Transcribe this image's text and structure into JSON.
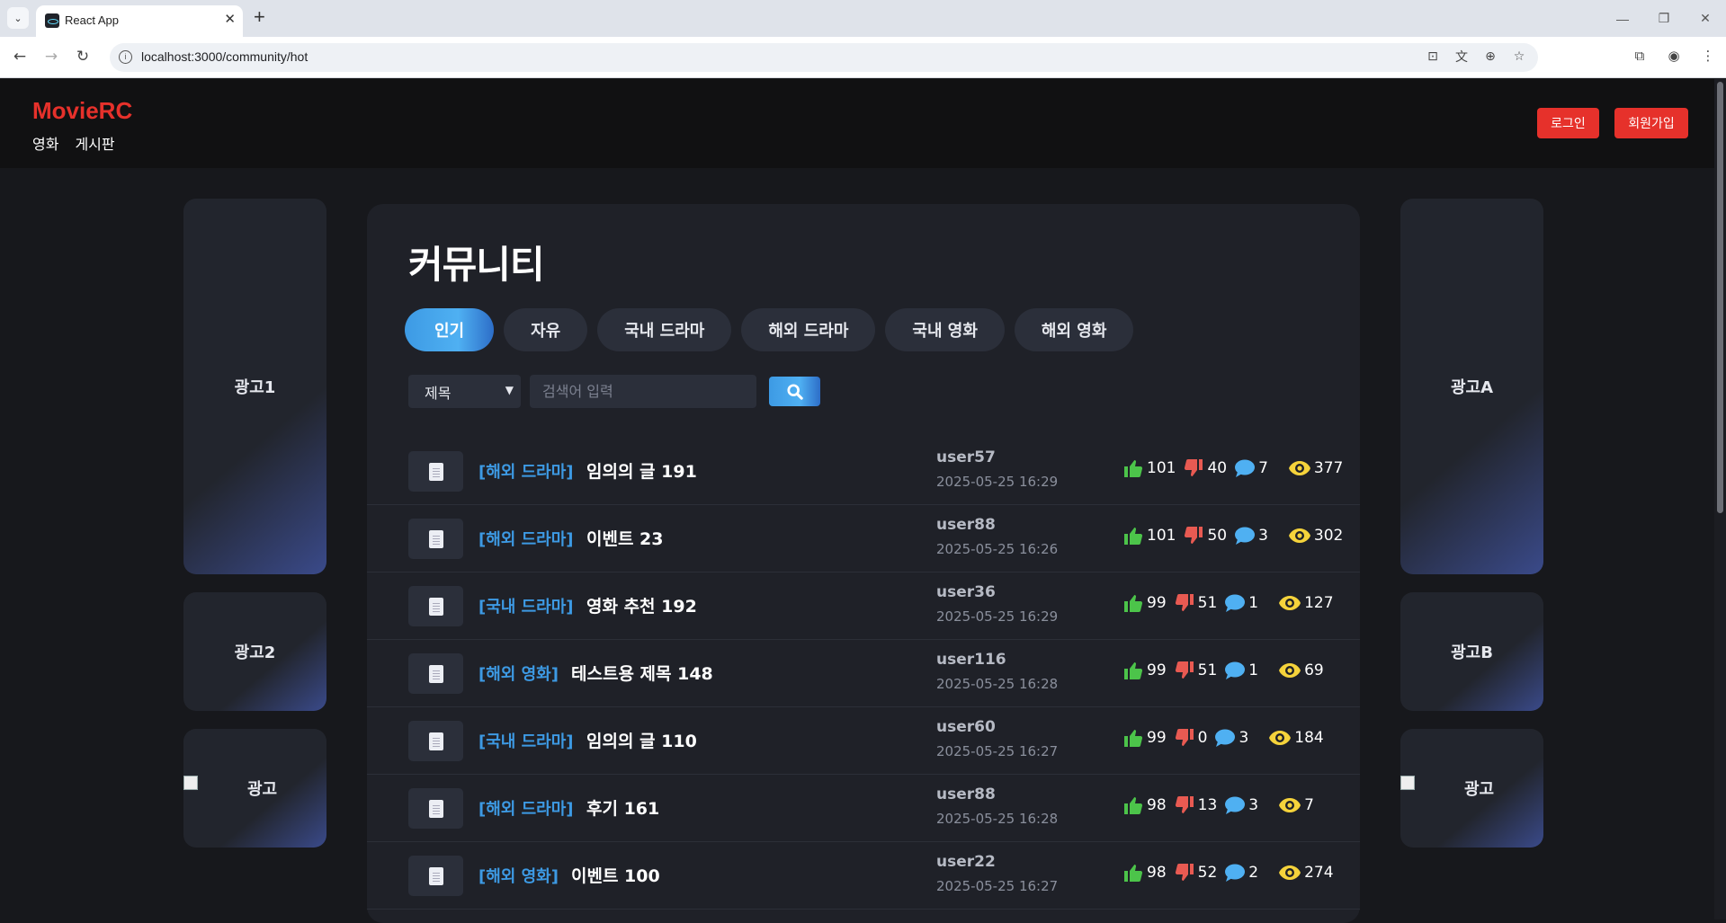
{
  "browser": {
    "tab_title": "React App",
    "url": "localhost:3000/community/hot"
  },
  "header": {
    "logo": "MovieRC",
    "nav": [
      "영화",
      "게시판"
    ],
    "login_label": "로그인",
    "signup_label": "회원가입"
  },
  "ads": {
    "left": [
      "광고1",
      "광고2",
      "광고"
    ],
    "right": [
      "광고A",
      "광고B",
      "광고"
    ]
  },
  "community": {
    "title": "커뮤니티",
    "categories": [
      "인기",
      "자유",
      "국내 드라마",
      "해외 드라마",
      "국내 영화",
      "해외 영화"
    ],
    "active_category": "인기",
    "search": {
      "select_value": "제목",
      "placeholder": "검색어 입력"
    },
    "posts": [
      {
        "category": "[해외 드라마]",
        "title": "임의의 글 191",
        "user": "user57",
        "date": "2025-05-25 16:29",
        "likes": "101",
        "dislikes": "40",
        "comments": "7",
        "views": "377"
      },
      {
        "category": "[해외 드라마]",
        "title": "이벤트 23",
        "user": "user88",
        "date": "2025-05-25 16:26",
        "likes": "101",
        "dislikes": "50",
        "comments": "3",
        "views": "302"
      },
      {
        "category": "[국내 드라마]",
        "title": "영화 추천 192",
        "user": "user36",
        "date": "2025-05-25 16:29",
        "likes": "99",
        "dislikes": "51",
        "comments": "1",
        "views": "127"
      },
      {
        "category": "[해외 영화]",
        "title": "테스트용 제목 148",
        "user": "user116",
        "date": "2025-05-25 16:28",
        "likes": "99",
        "dislikes": "51",
        "comments": "1",
        "views": "69"
      },
      {
        "category": "[국내 드라마]",
        "title": "임의의 글 110",
        "user": "user60",
        "date": "2025-05-25 16:27",
        "likes": "99",
        "dislikes": "0",
        "comments": "3",
        "views": "184"
      },
      {
        "category": "[해외 드라마]",
        "title": "후기 161",
        "user": "user88",
        "date": "2025-05-25 16:28",
        "likes": "98",
        "dislikes": "13",
        "comments": "3",
        "views": "7"
      },
      {
        "category": "[해외 영화]",
        "title": "이벤트 100",
        "user": "user22",
        "date": "2025-05-25 16:27",
        "likes": "98",
        "dislikes": "52",
        "comments": "2",
        "views": "274"
      }
    ]
  },
  "colors": {
    "accent": "#3d9ae4",
    "brand": "#e6312b",
    "like": "#4cc44a",
    "dislike": "#e85a52",
    "comment": "#4fb0f2",
    "views": "#f5d33b"
  }
}
